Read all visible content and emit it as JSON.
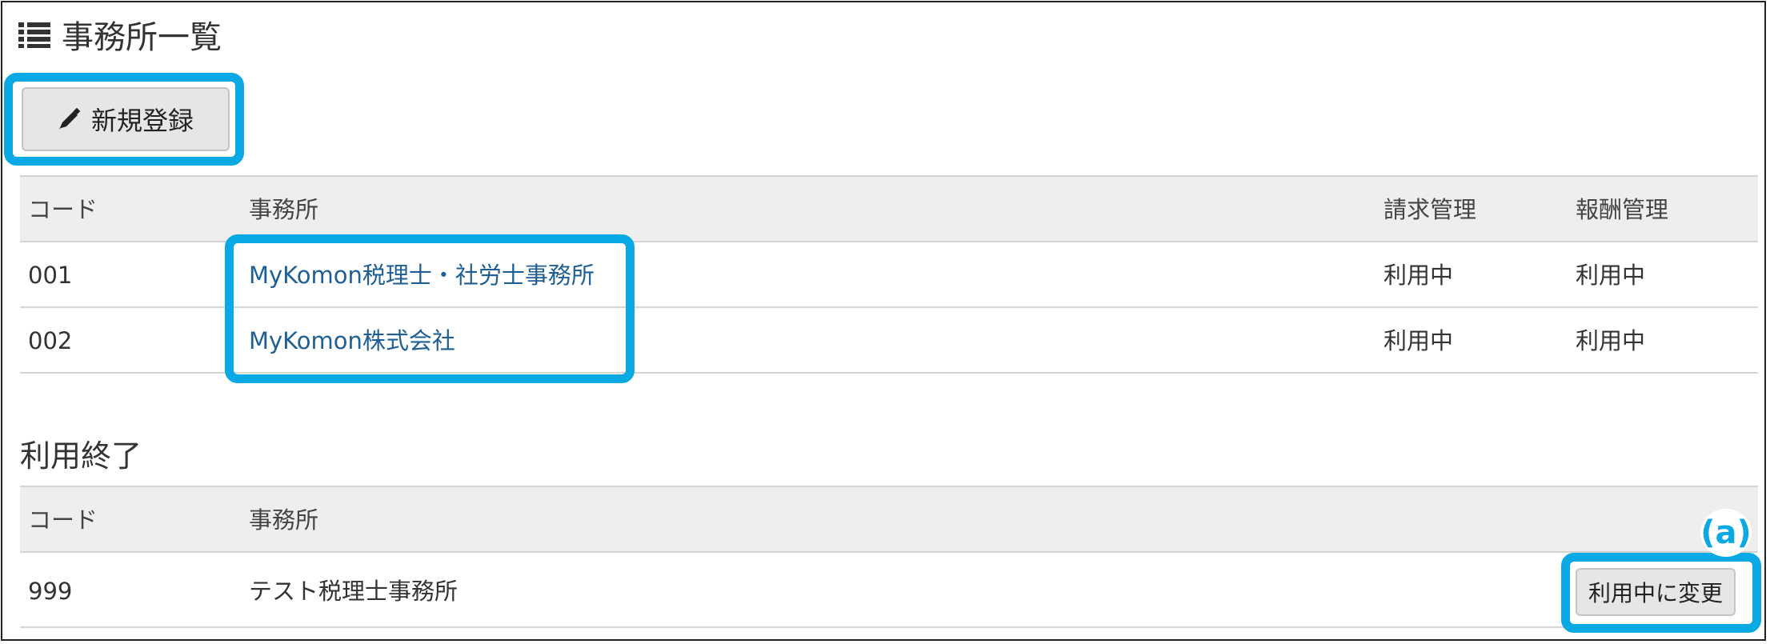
{
  "page": {
    "title": "事務所一覧",
    "title_icon": "list-icon"
  },
  "toolbar": {
    "new_label": "新規登録",
    "new_icon": "pencil-icon"
  },
  "active_table": {
    "headers": [
      "コード",
      "事務所",
      "請求管理",
      "報酬管理"
    ],
    "rows": [
      {
        "code": "001",
        "office": "MyKomon税理士・社労士事務所",
        "billing": "利用中",
        "fee": "利用中"
      },
      {
        "code": "002",
        "office": "MyKomon株式会社",
        "billing": "利用中",
        "fee": "利用中"
      }
    ]
  },
  "ended_section": {
    "title": "利用終了",
    "headers": [
      "コード",
      "事務所"
    ],
    "rows": [
      {
        "code": "999",
        "office": "テスト税理士事務所",
        "action_label": "利用中に変更"
      }
    ]
  },
  "annotation": {
    "marker_label": "(a)",
    "highlight_color": "#0aa9e6"
  },
  "colors": {
    "link": "#1e5f96",
    "header_bg": "#eeeeee",
    "button_bg": "#e6e6e6"
  }
}
